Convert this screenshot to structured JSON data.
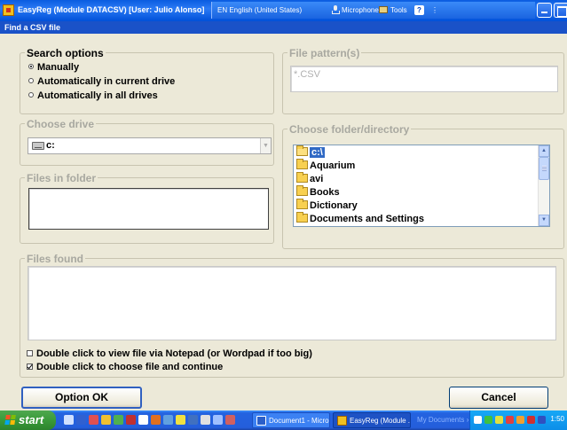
{
  "window": {
    "title": "EasyReg (Module DATACSV) [User: Julio Alonso]",
    "language": "EN English (United States)",
    "microphone": "Microphone",
    "tools": "Tools"
  },
  "dialog": {
    "title": "Find a CSV file"
  },
  "search_options": {
    "title": "Search options",
    "options": [
      {
        "label": "Manually",
        "selected": true
      },
      {
        "label": "Automatically in current drive",
        "selected": false
      },
      {
        "label": "Automatically in all drives",
        "selected": false
      }
    ]
  },
  "file_pattern": {
    "title": "File pattern(s)",
    "value": "*.CSV"
  },
  "choose_drive": {
    "title": "Choose drive",
    "value": "c:"
  },
  "files_in_folder": {
    "title": "Files in folder"
  },
  "choose_folder": {
    "title": "Choose folder/directory",
    "items": [
      {
        "label": "c:\\",
        "selected": true,
        "open": true
      },
      {
        "label": "Aquarium"
      },
      {
        "label": "avi"
      },
      {
        "label": "Books"
      },
      {
        "label": "Dictionary"
      },
      {
        "label": "Documents and Settings"
      }
    ]
  },
  "files_found": {
    "title": "Files found"
  },
  "checks": [
    {
      "label": "Double click to view file via Notepad (or Wordpad if too big)",
      "checked": false
    },
    {
      "label": "Double click to choose file and continue",
      "checked": true
    }
  ],
  "buttons": {
    "ok": "Option OK",
    "cancel": "Cancel"
  },
  "taskbar": {
    "start": "start",
    "tasks": [
      {
        "label": "Document1 - Micro..."
      },
      {
        "label": "EasyReg (Module ..."
      }
    ],
    "my_documents": "My Documents",
    "clock": "1:50"
  },
  "colors": {
    "title_bar": "#0a5ce0",
    "selection": "#316ac5",
    "taskbar": "#245edb",
    "start_button": "#3a9a3a"
  }
}
